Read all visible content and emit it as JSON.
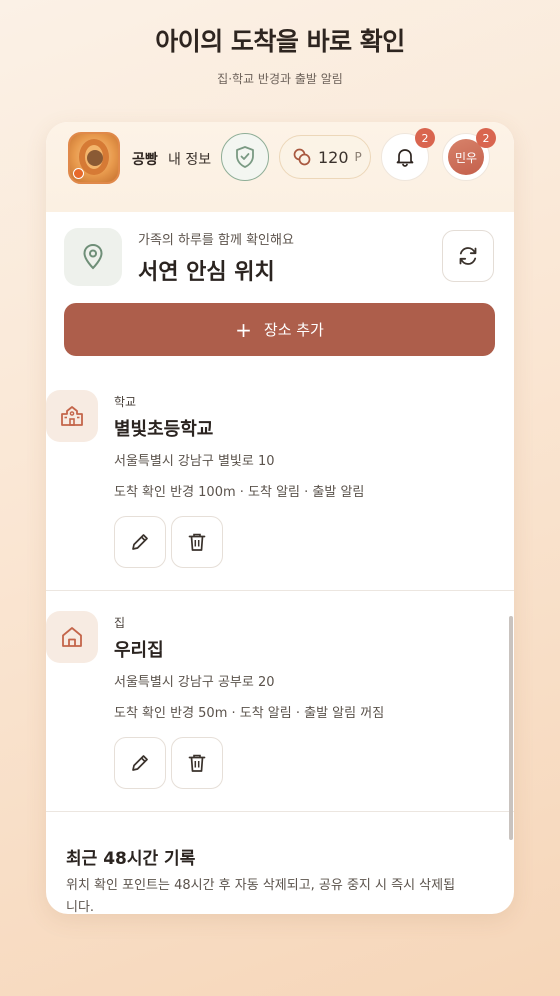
{
  "header": {
    "title": "아이의 도착을 바로 확인",
    "subtitle": "집·학교 반경과 출발 알림"
  },
  "topbar": {
    "pet_name": "공빵",
    "my_info_label": "내 정보",
    "points_value": "120",
    "points_unit": "P",
    "notification_count": "2",
    "user_name": "민우",
    "user_badge_count": "2"
  },
  "location_section": {
    "hint": "가족의 하루를 함께 확인해요",
    "title": "서연 안심 위치",
    "add_label": "장소 추가"
  },
  "places": [
    {
      "category": "학교",
      "name": "별빛초등학교",
      "address": "서울특별시 강남구 별빛로 10",
      "info": "도착 확인 반경 100m · 도착 알림 · 출발 알림",
      "icon": "school-icon"
    },
    {
      "category": "집",
      "name": "우리집",
      "address": "서울특별시 강남구 공부로 20",
      "info": "도착 확인 반경 50m · 도착 알림 · 출발 알림 꺼짐",
      "icon": "home-icon"
    }
  ],
  "recent": {
    "title": "최근 48시간 기록",
    "description": "위치 확인 포인트는 48시간 후 자동 삭제되고, 공유 중지 시 즉시 삭제됩니다."
  },
  "colors": {
    "accent": "#ad5e4b",
    "badge": "#d9654f",
    "shield": "#7a9a83",
    "icon_warm": "#c4654a"
  }
}
